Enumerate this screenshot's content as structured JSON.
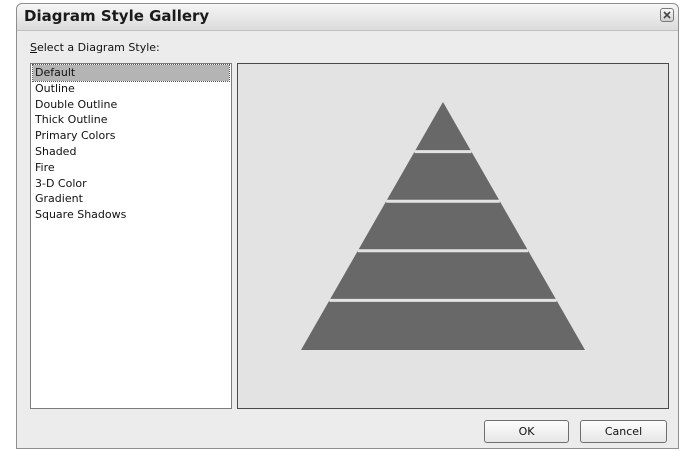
{
  "window": {
    "title": "Diagram Style Gallery"
  },
  "prompt": {
    "mnemonic": "S",
    "rest": "elect a Diagram Style:"
  },
  "styles": [
    "Default",
    "Outline",
    "Double Outline",
    "Thick Outline",
    "Primary Colors",
    "Shaded",
    "Fire",
    "3-D Color",
    "Gradient",
    "Square Shadows"
  ],
  "selected_style": "Default",
  "preview": {
    "shape": "pyramid",
    "levels": 5,
    "fill_color": "#686868",
    "separator_color": "#e3e3e3"
  },
  "buttons": {
    "ok": "OK",
    "cancel": "Cancel"
  },
  "icons": {
    "close": "close-icon"
  }
}
